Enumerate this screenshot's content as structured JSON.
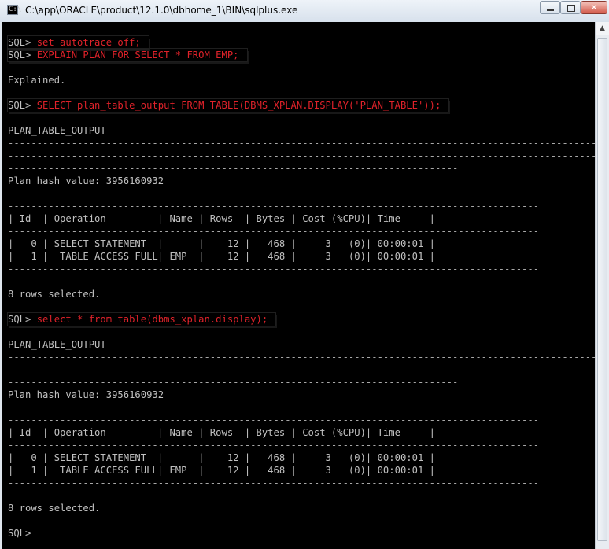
{
  "window": {
    "title": "C:\\app\\ORACLE\\product\\12.1.0\\dbhome_1\\BIN\\sqlplus.exe",
    "icon_text": "C:\\",
    "close_label": "✕"
  },
  "colors": {
    "console_bg": "#000000",
    "console_text": "#c0c0c0",
    "command_text": "#e0222a"
  },
  "console": {
    "lines": [
      {
        "prompt": "SQL> ",
        "command": "set autotrace off;",
        "boxed": true
      },
      {
        "prompt": "SQL> ",
        "command": "EXPLAIN PLAN FOR SELECT * FROM EMP;",
        "boxed": true
      },
      {
        "text": ""
      },
      {
        "text": "Explained."
      },
      {
        "text": ""
      },
      {
        "prompt": "SQL> ",
        "command": "SELECT plan_table_output FROM TABLE(DBMS_XPLAN.DISPLAY('PLAN_TABLE'));",
        "boxed": true
      },
      {
        "text": ""
      },
      {
        "text": "PLAN_TABLE_OUTPUT"
      },
      {
        "text": "------------------------------------------------------------------------------------------------------------------------",
        "dashed": true
      },
      {
        "text": "------------------------------------------------------------------------------------------------------------------------",
        "dashed": true
      },
      {
        "text": "------------------------------------------------------------------------------",
        "dashed": true
      },
      {
        "text": "Plan hash value: 3956160932"
      },
      {
        "text": ""
      },
      {
        "text": "--------------------------------------------------------------------------------------------",
        "dashed": true
      },
      {
        "text": "| Id  | Operation         | Name | Rows  | Bytes | Cost (%CPU)| Time     |"
      },
      {
        "text": "--------------------------------------------------------------------------------------------",
        "dashed": true
      },
      {
        "text": "|   0 | SELECT STATEMENT  |      |    12 |   468 |     3   (0)| 00:00:01 |"
      },
      {
        "text": "|   1 |  TABLE ACCESS FULL| EMP  |    12 |   468 |     3   (0)| 00:00:01 |"
      },
      {
        "text": "--------------------------------------------------------------------------------------------",
        "dashed": true
      },
      {
        "text": ""
      },
      {
        "text": "8 rows selected."
      },
      {
        "text": ""
      },
      {
        "prompt": "SQL> ",
        "command": "select * from table(dbms_xplan.display);",
        "boxed": true
      },
      {
        "text": ""
      },
      {
        "text": "PLAN_TABLE_OUTPUT"
      },
      {
        "text": "------------------------------------------------------------------------------------------------------------------------",
        "dashed": true
      },
      {
        "text": "------------------------------------------------------------------------------------------------------------------------",
        "dashed": true
      },
      {
        "text": "------------------------------------------------------------------------------",
        "dashed": true
      },
      {
        "text": "Plan hash value: 3956160932"
      },
      {
        "text": ""
      },
      {
        "text": "--------------------------------------------------------------------------------------------",
        "dashed": true
      },
      {
        "text": "| Id  | Operation         | Name | Rows  | Bytes | Cost (%CPU)| Time     |"
      },
      {
        "text": "--------------------------------------------------------------------------------------------",
        "dashed": true
      },
      {
        "text": "|   0 | SELECT STATEMENT  |      |    12 |   468 |     3   (0)| 00:00:01 |"
      },
      {
        "text": "|   1 |  TABLE ACCESS FULL| EMP  |    12 |   468 |     3   (0)| 00:00:01 |"
      },
      {
        "text": "--------------------------------------------------------------------------------------------",
        "dashed": true
      },
      {
        "text": ""
      },
      {
        "text": "8 rows selected."
      },
      {
        "text": ""
      },
      {
        "prompt": "SQL> ",
        "command": ""
      }
    ]
  },
  "scrollbar": {
    "up_arrow": "▲"
  }
}
